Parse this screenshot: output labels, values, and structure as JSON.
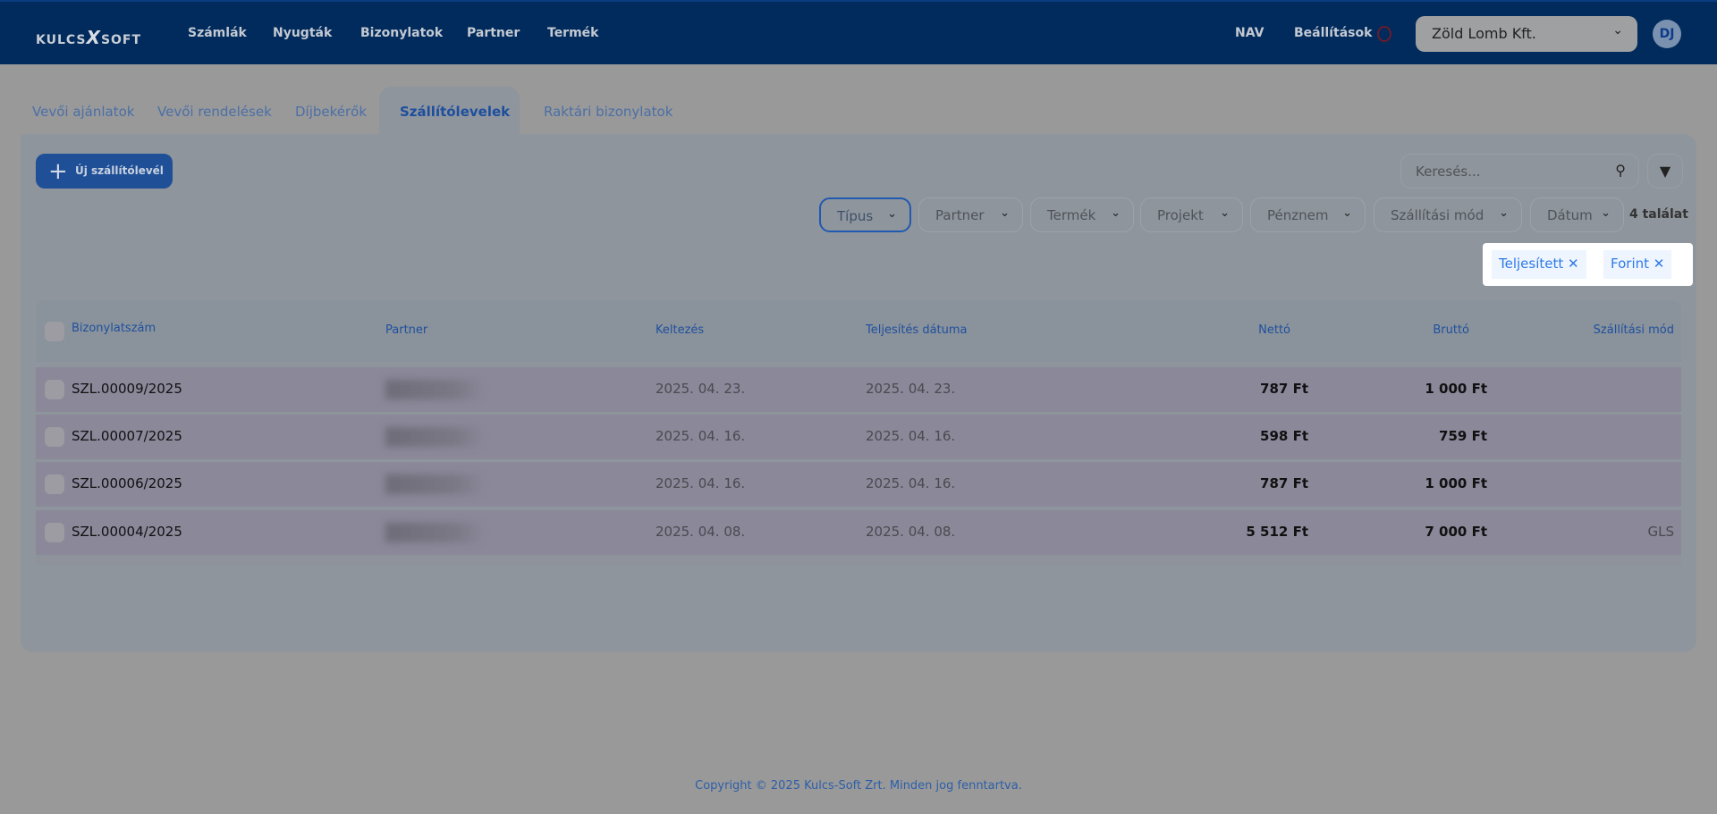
{
  "header": {
    "logo": "KULCS-SOFT",
    "logo_left": "KULCS",
    "logo_x": "X",
    "logo_right": "SOFT",
    "nav": [
      "Számlák",
      "Nyugták",
      "Bizonylatok",
      "Partner",
      "Termék"
    ],
    "nav_right": [
      "NAV",
      "Beállítások"
    ],
    "company": "Zöld Lomb Kft.",
    "avatar": "DJ"
  },
  "tabs": [
    "Vevői ajánlatok",
    "Vevői rendelések",
    "Díjbekérők",
    "Szállítólevelek",
    "Raktári bizonylatok"
  ],
  "active_tab": "Szállítólevelek",
  "toolbar": {
    "new_label": "Új szállítólevél",
    "search_placeholder": "Keresés...",
    "filters": [
      "Típus",
      "Partner",
      "Termék",
      "Projekt",
      "Pénznem",
      "Szállítási mód",
      "Dátum"
    ],
    "result_count": "4 találat",
    "chips": [
      "Teljesített",
      "Forint"
    ]
  },
  "table": {
    "columns": [
      "Bizonylatszám",
      "Partner",
      "Keltezés",
      "Teljesítés dátuma",
      "Nettó",
      "Bruttó",
      "Szállítási mód"
    ],
    "rows": [
      {
        "id": "SZL.00009/2025",
        "date": "2025. 04. 23.",
        "fulfil": "2025. 04. 23.",
        "net": "787 Ft",
        "gross": "1 000 Ft",
        "shipping": ""
      },
      {
        "id": "SZL.00007/2025",
        "date": "2025. 04. 16.",
        "fulfil": "2025. 04. 16.",
        "net": "598 Ft",
        "gross": "759 Ft",
        "shipping": ""
      },
      {
        "id": "SZL.00006/2025",
        "date": "2025. 04. 16.",
        "fulfil": "2025. 04. 16.",
        "net": "787 Ft",
        "gross": "1 000 Ft",
        "shipping": ""
      },
      {
        "id": "SZL.00004/2025",
        "date": "2025. 04. 08.",
        "fulfil": "2025. 04. 08.",
        "net": "5 512 Ft",
        "gross": "7 000 Ft",
        "shipping": "GLS"
      }
    ]
  },
  "footer": "Copyright © 2025 Kulcs-Soft Zrt. Minden jog fenntartva.",
  "colors": {
    "header": "#002b5c",
    "accent": "#1f4f96",
    "chip_text": "#2f7ae5"
  }
}
